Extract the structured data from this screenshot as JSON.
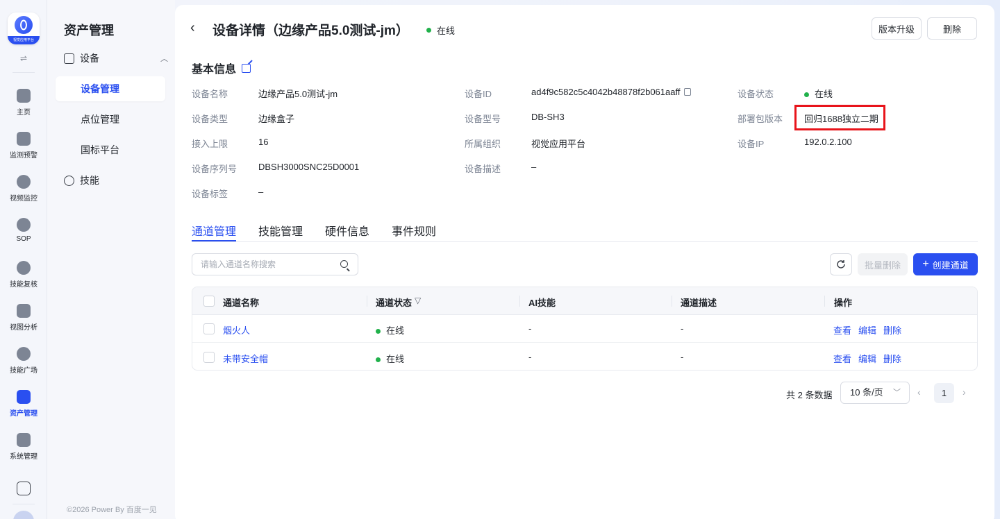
{
  "rail": {
    "logo_text": "视觉应用平台",
    "items": [
      {
        "label": "主页",
        "icon": "home-icon"
      },
      {
        "label": "监测预警",
        "icon": "chart-line-icon"
      },
      {
        "label": "视频监控",
        "icon": "camera-icon"
      },
      {
        "label": "SOP",
        "icon": "sop-icon"
      },
      {
        "label": "技能复核",
        "icon": "hexagon-icon"
      },
      {
        "label": "视图分析",
        "icon": "image-search-icon"
      },
      {
        "label": "技能广场",
        "icon": "cluster-icon"
      },
      {
        "label": "资产管理",
        "icon": "asset-icon",
        "active": true
      },
      {
        "label": "系统管理",
        "icon": "settings-panel-icon"
      }
    ]
  },
  "sidebar": {
    "title": "资产管理",
    "group_device": "设备",
    "items": [
      "设备管理",
      "点位管理",
      "国标平台"
    ],
    "group_skill": "技能",
    "footer": "©2026 Power By 百度一见"
  },
  "header": {
    "title": "设备详情（边缘产品5.0测试-jm）",
    "status": "在线",
    "upgrade_button": "版本升级",
    "delete_button": "删除"
  },
  "basic": {
    "title": "基本信息",
    "fields": [
      {
        "key": "设备名称",
        "value": "边缘产品5.0测试-jm"
      },
      {
        "key": "设备ID",
        "value": "ad4f9c582c5c4042b48878f2b061aaff"
      },
      {
        "key": "设备状态",
        "value": "在线"
      },
      {
        "key": "设备类型",
        "value": "边缘盒子"
      },
      {
        "key": "设备型号",
        "value": "DB-SH3"
      },
      {
        "key": "部署包版本",
        "value": "回归1688独立二期"
      },
      {
        "key": "接入上限",
        "value": "16"
      },
      {
        "key": "所属组织",
        "value": "视觉应用平台"
      },
      {
        "key": "设备IP",
        "value": "192.0.2.100"
      },
      {
        "key": "设备序列号",
        "value": "DBSH3000SNC25D0001"
      },
      {
        "key": "设备描述",
        "value": "–"
      },
      {
        "key": "设备标签",
        "value": "–"
      }
    ]
  },
  "tabs": [
    "通道管理",
    "技能管理",
    "硬件信息",
    "事件规则"
  ],
  "toolbar": {
    "search_placeholder": "请输入通道名称搜索",
    "batch_delete": "批量删除",
    "create_channel": "创建通道"
  },
  "table": {
    "headers": [
      "通道名称",
      "通道状态",
      "AI技能",
      "通道描述",
      "操作"
    ],
    "rows": [
      {
        "name": "烟火人",
        "status": "在线",
        "ai": "-",
        "desc": "-"
      },
      {
        "name": "未带安全帽",
        "status": "在线",
        "ai": "-",
        "desc": "-"
      }
    ],
    "actions": [
      "查看",
      "编辑",
      "删除"
    ]
  },
  "pager": {
    "total": "共 2 条数据",
    "page_size": "10 条/页",
    "current_page": "1"
  },
  "colors": {
    "accent": "#2a4ff0",
    "online": "#21b14b",
    "highlight": "#e8141b"
  }
}
